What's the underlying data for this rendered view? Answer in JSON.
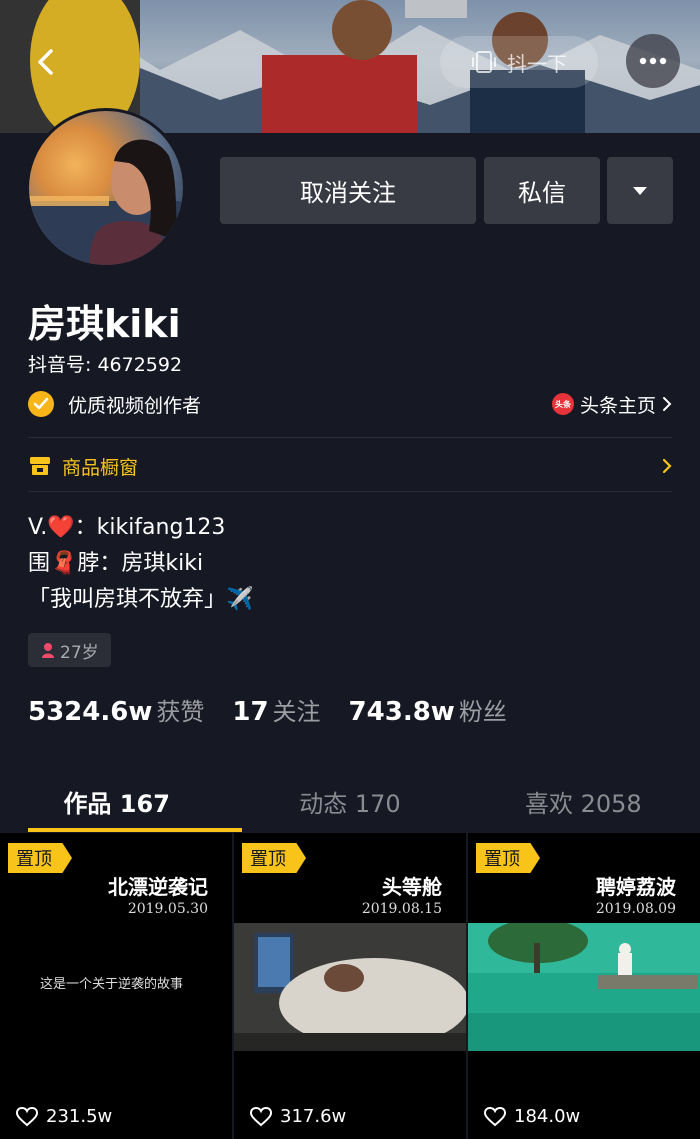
{
  "header": {
    "shake_label": "抖一下"
  },
  "actions": {
    "unfollow_label": "取消关注",
    "message_label": "私信"
  },
  "profile": {
    "nickname": "房琪kiki",
    "douyin_id": "抖音号: 4672592",
    "verification": "优质视频创作者",
    "toutiao_label": "头条主页",
    "toutiao_logo_text": "头条",
    "shop_label": "商品橱窗",
    "bio": [
      "V.❤️：kikifang123",
      "围🧣脖：房琪kiki",
      "「我叫房琪不放弃」✈️"
    ],
    "age": "27岁"
  },
  "stats": [
    {
      "value": "5324.6w",
      "label": "获赞"
    },
    {
      "value": "17",
      "label": "关注"
    },
    {
      "value": "743.8w",
      "label": "粉丝"
    }
  ],
  "tabs": [
    {
      "label": "作品 167",
      "active": true
    },
    {
      "label": "动态 170",
      "active": false
    },
    {
      "label": "喜欢 2058",
      "active": false
    }
  ],
  "videos": [
    {
      "pin": "置顶",
      "title": "北漂逆袭记",
      "date": "2019.05.30",
      "subtitle": "这是一个关于逆袭的故事",
      "likes": "231.5w"
    },
    {
      "pin": "置顶",
      "title": "头等舱",
      "date": "2019.08.15",
      "subtitle": "",
      "likes": "317.6w"
    },
    {
      "pin": "置顶",
      "title": "聘婷荔波",
      "date": "2019.08.09",
      "subtitle": "",
      "likes": "184.0w"
    }
  ],
  "colors": {
    "background": "#161823",
    "accent": "#f8c41a",
    "button": "#393b44"
  }
}
